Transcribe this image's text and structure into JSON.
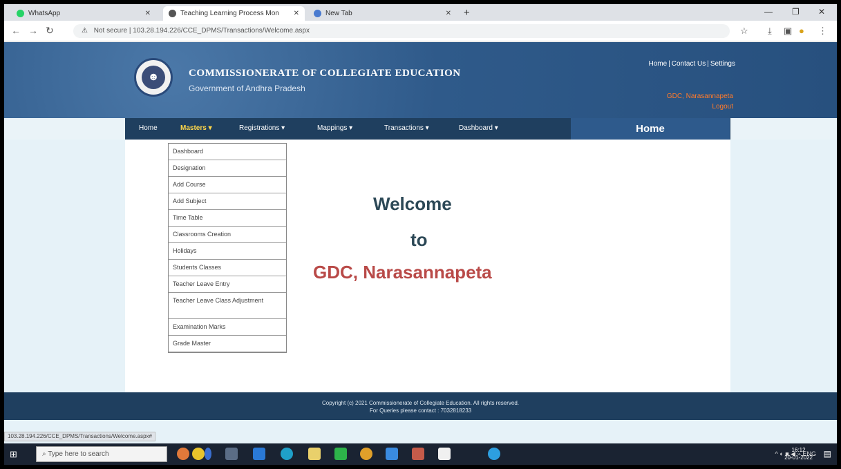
{
  "browser": {
    "tabs": [
      {
        "label": "WhatsApp",
        "icon": "whatsapp-icon",
        "color": "#25d366",
        "active": false
      },
      {
        "label": "Teaching Learning Process Mon",
        "icon": "site-icon",
        "color": "#555555",
        "active": true
      },
      {
        "label": "New Tab",
        "icon": "chrome-icon",
        "color": "#4a7bd0",
        "active": false
      }
    ],
    "new_tab": "+",
    "address": {
      "security": "Not secure",
      "url": "103.28.194.226/CCE_DPMS/Transactions/Welcome.aspx"
    },
    "window_controls": [
      "—",
      "❐",
      "✕"
    ]
  },
  "site": {
    "title": "COMMISSIONERATE OF COLLEGIATE EDUCATION",
    "subtitle": "Government of Andhra Pradesh",
    "top_links": [
      "Home",
      "Contact Us",
      "Settings"
    ],
    "user_line1": "GDC, Narasannapeta",
    "user_line2": "Logout"
  },
  "nav": {
    "items": [
      {
        "label": "Home",
        "highlight": false
      },
      {
        "label": "Masters ▾",
        "highlight": true
      },
      {
        "label": "Registrations ▾",
        "highlight": false
      },
      {
        "label": "Mappings ▾",
        "highlight": false
      },
      {
        "label": "Transactions ▾",
        "highlight": false
      },
      {
        "label": "Dashboard ▾",
        "highlight": false
      }
    ],
    "page_heading": "Home"
  },
  "masters_menu": [
    "Dashboard",
    "Designation",
    "Add Course",
    "Add Subject",
    "Time Table",
    "Classrooms Creation",
    "Holidays",
    "Students Classes",
    "Teacher Leave Entry",
    "Teacher Leave Class Adjustment",
    "Examination Marks",
    "Grade Master"
  ],
  "welcome": {
    "line1": "Welcome",
    "line2": "to",
    "line3": "GDC, Narasannapeta"
  },
  "footer": {
    "line1": "Copyright (c) 2021 Commissionerate of Collegiate Education. All rights reserved.",
    "line2": "For Queries please contact : 7032818233"
  },
  "status_url": "103.28.194.226/CCE_DPMS/Transactions/Welcome.aspx#",
  "taskbar": {
    "search_placeholder": "Type here to search",
    "tray": "ENG",
    "time": "16:12",
    "date": "20-01-2022"
  }
}
